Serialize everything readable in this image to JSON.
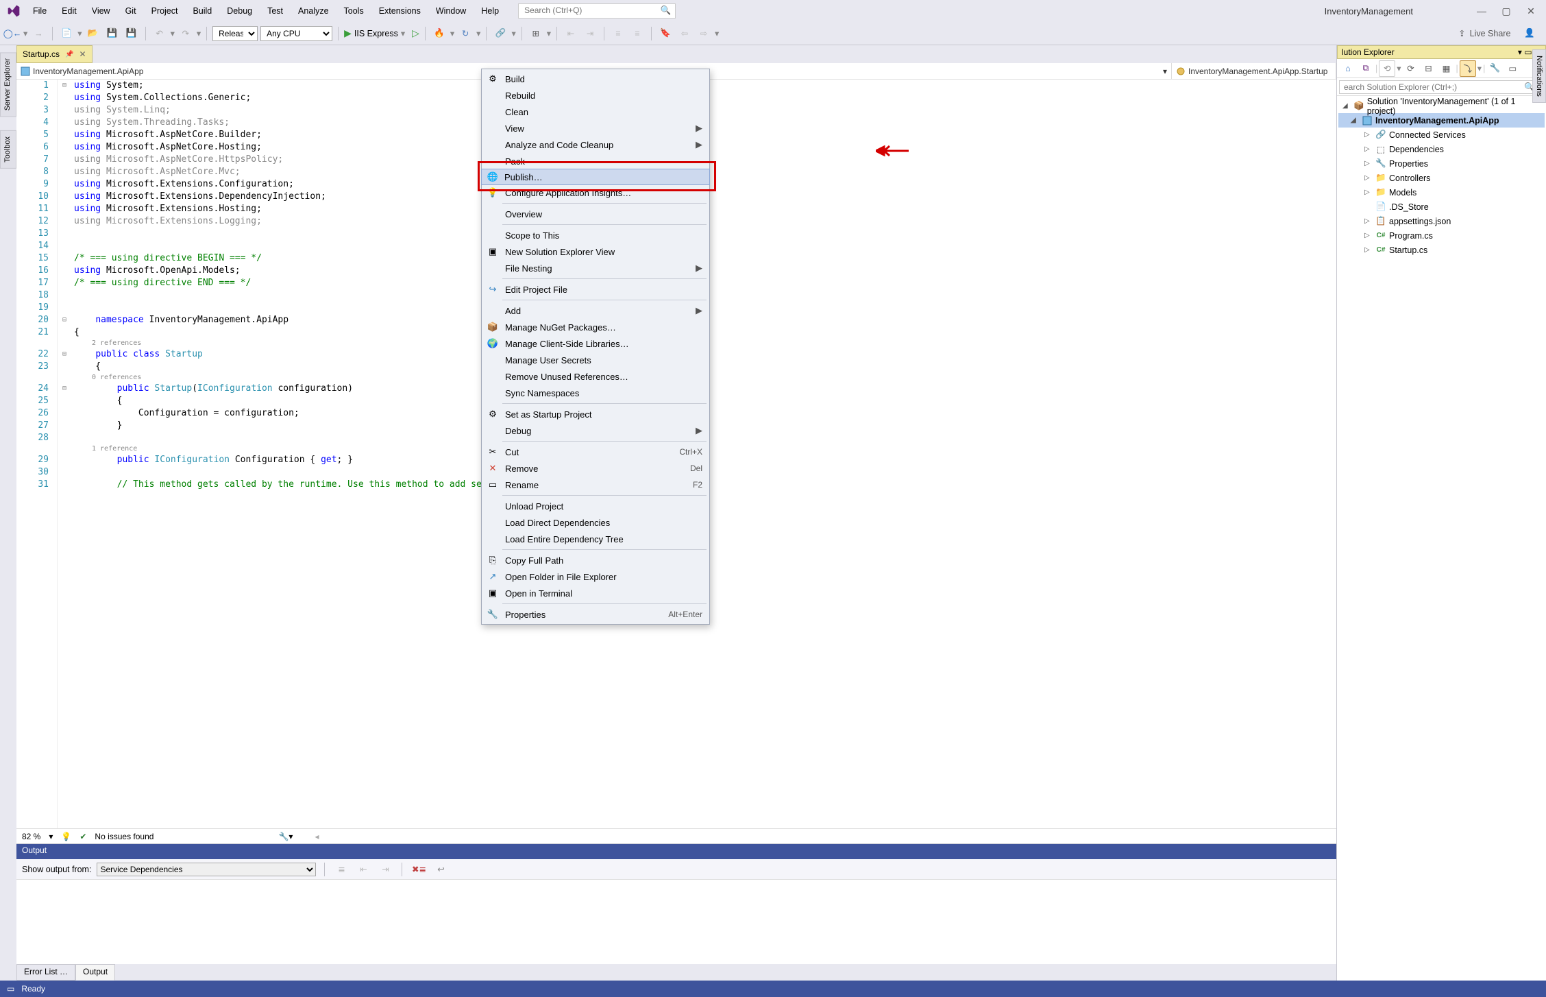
{
  "app_name": "InventoryManagement",
  "menubar": [
    "File",
    "Edit",
    "View",
    "Git",
    "Project",
    "Build",
    "Debug",
    "Test",
    "Analyze",
    "Tools",
    "Extensions",
    "Window",
    "Help"
  ],
  "search_placeholder": "Search (Ctrl+Q)",
  "toolbar": {
    "config": "Release",
    "platform": "Any CPU",
    "run_target": "IIS Express",
    "live_share": "Live Share"
  },
  "side_tabs": [
    "Server Explorer",
    "Toolbox"
  ],
  "right_tab": "Notifications",
  "doc_tab": "Startup.cs",
  "nav1": "InventoryManagement.ApiApp",
  "nav2": "InventoryManagement.ApiApp.Startup",
  "code_lines": [
    {
      "n": 1,
      "html": "<span class='kw'>using</span> System;"
    },
    {
      "n": 2,
      "html": "<span class='kw'>using</span> System.Collections.Generic;"
    },
    {
      "n": 3,
      "html": "<span class='gray'>using System.Linq;</span>"
    },
    {
      "n": 4,
      "html": "<span class='gray'>using System.Threading.Tasks;</span>"
    },
    {
      "n": 5,
      "html": "<span class='kw'>using</span> Microsoft.AspNetCore.Builder;"
    },
    {
      "n": 6,
      "html": "<span class='kw'>using</span> Microsoft.AspNetCore.Hosting;"
    },
    {
      "n": 7,
      "html": "<span class='gray'>using Microsoft.AspNetCore.HttpsPolicy;</span>"
    },
    {
      "n": 8,
      "html": "<span class='gray'>using Microsoft.AspNetCore.Mvc;</span>"
    },
    {
      "n": 9,
      "html": "<span class='kw'>using</span> Microsoft.Extensions.Configuration;"
    },
    {
      "n": 10,
      "html": "<span class='kw'>using</span> Microsoft.Extensions.DependencyInjection;"
    },
    {
      "n": 11,
      "html": "<span class='kw'>using</span> Microsoft.Extensions.Hosting;"
    },
    {
      "n": 12,
      "html": "<span class='gray'>using Microsoft.Extensions.Logging;</span>"
    },
    {
      "n": 13,
      "html": ""
    },
    {
      "n": 14,
      "html": ""
    },
    {
      "n": 15,
      "html": "<span class='cmt'>/* === using directive BEGIN === */</span>"
    },
    {
      "n": 16,
      "html": "<span class='kw'>using</span> Microsoft.OpenApi.Models;"
    },
    {
      "n": 17,
      "html": "<span class='cmt'>/* === using directive END === */</span>"
    },
    {
      "n": 18,
      "html": ""
    },
    {
      "n": 19,
      "html": ""
    },
    {
      "n": 20,
      "html": "    <span class='kw'>namespace</span> InventoryManagement.ApiApp"
    },
    {
      "n": 21,
      "html": "{"
    },
    {
      "n": 0,
      "refs": "2 references"
    },
    {
      "n": 22,
      "html": "    <span class='kw'>public</span> <span class='kw'>class</span> <span class='type'>Startup</span>"
    },
    {
      "n": 23,
      "html": "    {"
    },
    {
      "n": 0,
      "refs": "0 references"
    },
    {
      "n": 24,
      "html": "        <span class='kw'>public</span> <span class='type'>Startup</span>(<span class='type'>IConfiguration</span> configuration)"
    },
    {
      "n": 25,
      "html": "        {"
    },
    {
      "n": 26,
      "html": "            Configuration = configuration;"
    },
    {
      "n": 27,
      "html": "        }"
    },
    {
      "n": 28,
      "html": ""
    },
    {
      "n": 0,
      "refs": "1 reference"
    },
    {
      "n": 29,
      "html": "        <span class='kw'>public</span> <span class='type'>IConfiguration</span> Configuration { <span class='kw'>get</span>; }"
    },
    {
      "n": 30,
      "html": ""
    },
    {
      "n": 31,
      "html": "        <span class='cmt'>// This method gets called by the runtime. Use this method to add services to</span>"
    }
  ],
  "editor_status": {
    "zoom": "82 %",
    "issues": "No issues found"
  },
  "output": {
    "title": "Output",
    "label": "Show output from:",
    "source": "Service Dependencies"
  },
  "output_tabs": [
    "Error List …",
    "Output"
  ],
  "se": {
    "title": "lution Explorer",
    "search_placeholder": "earch Solution Explorer (Ctrl+;)",
    "root": "Solution 'InventoryManagement' (1 of 1 project)",
    "project": "InventoryManagement.ApiApp",
    "children": [
      {
        "label": "Connected Services",
        "exp": "▷",
        "icon": "connected"
      },
      {
        "label": "Dependencies",
        "exp": "▷",
        "icon": "deps"
      },
      {
        "label": "Properties",
        "exp": "▷",
        "icon": "wrench"
      },
      {
        "label": "Controllers",
        "exp": "▷",
        "icon": "folder"
      },
      {
        "label": "Models",
        "exp": "▷",
        "icon": "folder"
      },
      {
        "label": ".DS_Store",
        "exp": "",
        "icon": "file"
      },
      {
        "label": "appsettings.json",
        "exp": "▷",
        "icon": "json"
      },
      {
        "label": "Program.cs",
        "exp": "▷",
        "icon": "cs"
      },
      {
        "label": "Startup.cs",
        "exp": "▷",
        "icon": "cs"
      }
    ]
  },
  "ctx_menu": [
    {
      "label": "Build",
      "type": "item",
      "icon": "build"
    },
    {
      "label": "Rebuild",
      "type": "item"
    },
    {
      "label": "Clean",
      "type": "item"
    },
    {
      "label": "View",
      "type": "sub"
    },
    {
      "label": "Analyze and Code Cleanup",
      "type": "sub"
    },
    {
      "label": "Pack",
      "type": "item"
    },
    {
      "label": "Publish…",
      "type": "item",
      "icon": "publish",
      "hover": true
    },
    {
      "label": "Configure Application Insights…",
      "type": "item",
      "icon": "insights"
    },
    {
      "type": "sep"
    },
    {
      "label": "Overview",
      "type": "item"
    },
    {
      "type": "sep"
    },
    {
      "label": "Scope to This",
      "type": "item"
    },
    {
      "label": "New Solution Explorer View",
      "type": "item",
      "icon": "newview"
    },
    {
      "label": "File Nesting",
      "type": "sub"
    },
    {
      "type": "sep"
    },
    {
      "label": "Edit Project File",
      "type": "item",
      "icon": "edit"
    },
    {
      "type": "sep"
    },
    {
      "label": "Add",
      "type": "sub"
    },
    {
      "label": "Manage NuGet Packages…",
      "type": "item",
      "icon": "nuget"
    },
    {
      "label": "Manage Client-Side Libraries…",
      "type": "item",
      "icon": "client"
    },
    {
      "label": "Manage User Secrets",
      "type": "item"
    },
    {
      "label": "Remove Unused References…",
      "type": "item"
    },
    {
      "label": "Sync Namespaces",
      "type": "item"
    },
    {
      "type": "sep"
    },
    {
      "label": "Set as Startup Project",
      "type": "item",
      "icon": "startup"
    },
    {
      "label": "Debug",
      "type": "sub"
    },
    {
      "type": "sep"
    },
    {
      "label": "Cut",
      "type": "item",
      "kb": "Ctrl+X",
      "icon": "cut"
    },
    {
      "label": "Remove",
      "type": "item",
      "kb": "Del",
      "icon": "remove"
    },
    {
      "label": "Rename",
      "type": "item",
      "kb": "F2",
      "icon": "rename"
    },
    {
      "type": "sep"
    },
    {
      "label": "Unload Project",
      "type": "item"
    },
    {
      "label": "Load Direct Dependencies",
      "type": "item"
    },
    {
      "label": "Load Entire Dependency Tree",
      "type": "item"
    },
    {
      "type": "sep"
    },
    {
      "label": "Copy Full Path",
      "type": "item",
      "icon": "copy"
    },
    {
      "label": "Open Folder in File Explorer",
      "type": "item",
      "icon": "openfolder"
    },
    {
      "label": "Open in Terminal",
      "type": "item",
      "icon": "terminal"
    },
    {
      "type": "sep"
    },
    {
      "label": "Properties",
      "type": "item",
      "kb": "Alt+Enter",
      "icon": "props"
    }
  ],
  "status": "Ready"
}
